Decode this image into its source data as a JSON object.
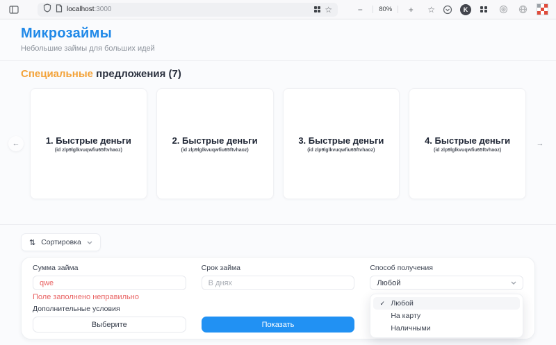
{
  "browser": {
    "address": {
      "host": "localhost",
      "port": ":3000"
    },
    "zoom": {
      "minus": "−",
      "level": "80%",
      "plus": "+"
    }
  },
  "glyphs": {
    "star": "☆",
    "save_star": "☆",
    "prev": "←",
    "next": "→",
    "sort": "⇅",
    "check": "✓",
    "kagi": "K"
  },
  "colors": {
    "accent_blue": "#2089e8",
    "accent_orange": "#f3a33a",
    "error_red": "#e96363",
    "button_blue": "#2191f3"
  },
  "page": {
    "title": "Микрозаймы",
    "subtitle": "Небольшие займы для больших идей",
    "offers": {
      "heading_accent": "Специальные",
      "heading_rest": "предложения (7)",
      "cards": [
        {
          "title": "1. Быстрые деньги",
          "id": "(id zlp9lglkvuqwfiu65ftvhaoz)"
        },
        {
          "title": "2. Быстрые деньги",
          "id": "(id zlp9lglkvuqwfiu65ftvhaoz)"
        },
        {
          "title": "3. Быстрые деньги",
          "id": "(id zlp9lglkvuqwfiu65ftvhaoz)"
        },
        {
          "title": "4. Быстрые деньги",
          "id": "(id zlp9lglkvuqwfiu65ftvhaoz)"
        }
      ]
    },
    "filter": {
      "sort": "Сортировка",
      "amount_label": "Сумма займа",
      "amount_value": "qwe",
      "amount_error": "Поле заполнено неправильно",
      "term_label": "Срок займа",
      "term_placeholder": "В днях",
      "method_label": "Способ получения",
      "method_value": "Любой",
      "method_options": [
        "Любой",
        "На карту",
        "Наличными"
      ],
      "extra_label": "Дополнительные условия",
      "choose": "Выберите",
      "show": "Показать"
    }
  }
}
